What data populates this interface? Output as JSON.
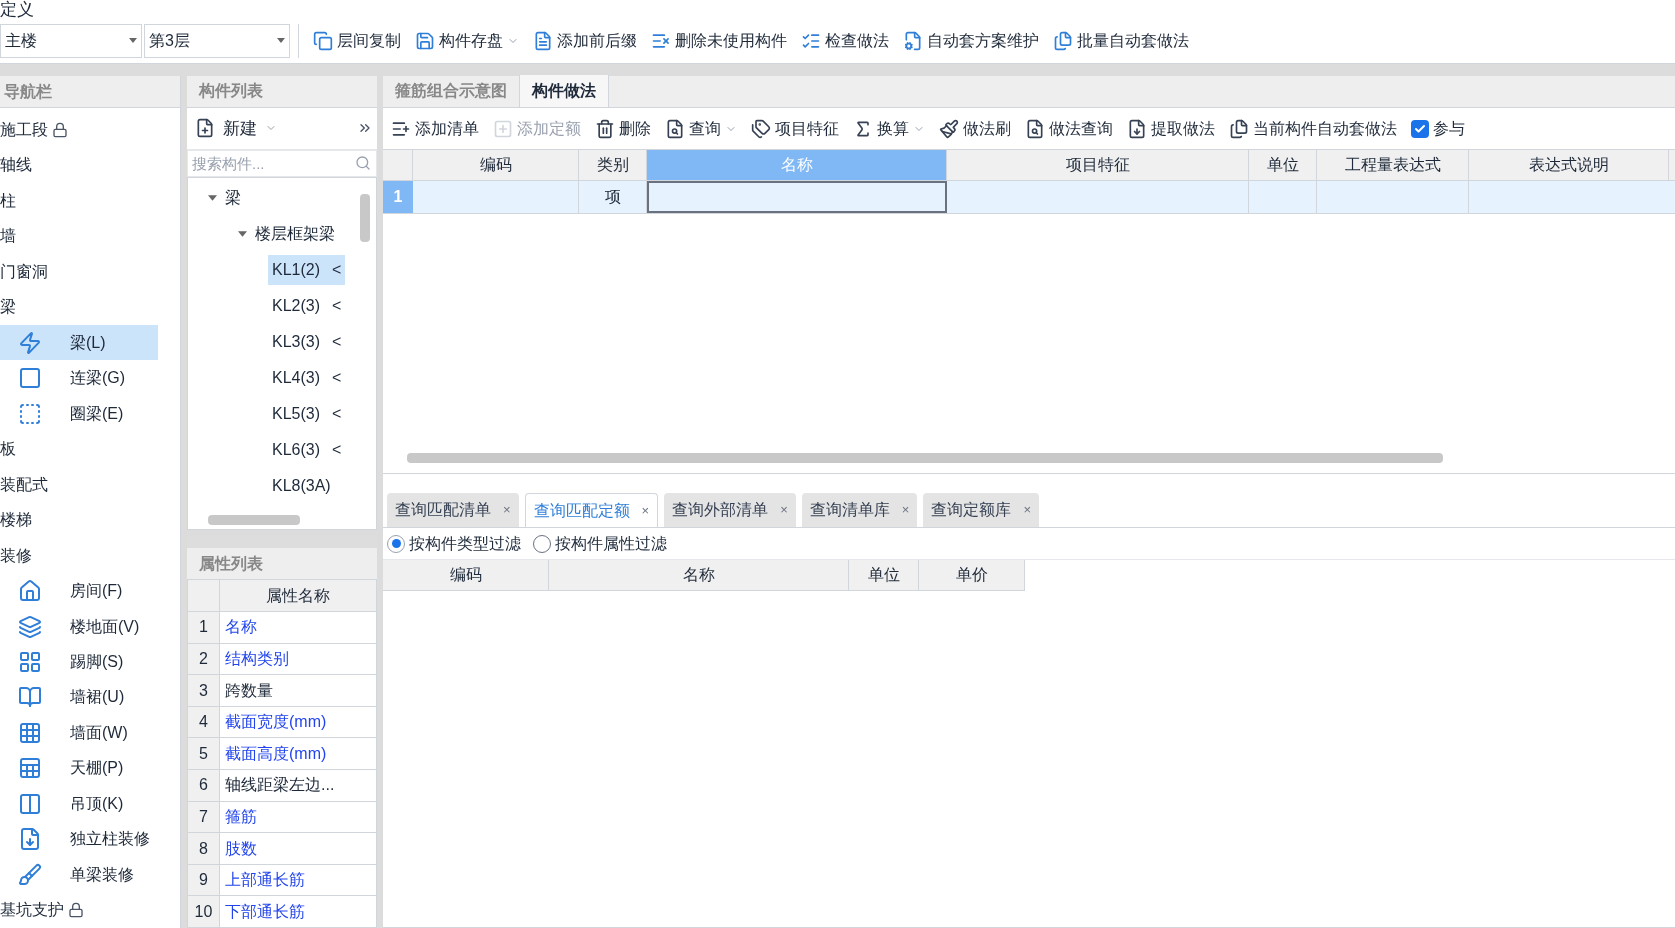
{
  "window": {
    "title": "定义"
  },
  "toolbar": {
    "building": "主楼",
    "floor": "第3层",
    "buttons": [
      {
        "label": "层间复制",
        "dropdown": false
      },
      {
        "label": "构件存盘",
        "dropdown": true
      },
      {
        "label": "添加前后缀",
        "dropdown": false
      },
      {
        "label": "删除未使用构件",
        "dropdown": false
      },
      {
        "label": "检查做法",
        "dropdown": false
      },
      {
        "label": "自动套方案维护",
        "dropdown": false
      },
      {
        "label": "批量自动套做法",
        "dropdown": false
      }
    ]
  },
  "navigation": {
    "title": "导航栏",
    "items": [
      {
        "kind": "group",
        "label": "施工段",
        "locked": true
      },
      {
        "kind": "group",
        "label": "轴线",
        "locked": false
      },
      {
        "kind": "group",
        "label": "柱",
        "locked": false
      },
      {
        "kind": "group",
        "label": "墙",
        "locked": false
      },
      {
        "kind": "group",
        "label": "门窗洞",
        "locked": false
      },
      {
        "kind": "group",
        "label": "梁",
        "locked": false
      },
      {
        "kind": "item",
        "label": "梁(L)",
        "selected": true
      },
      {
        "kind": "item",
        "label": "连梁(G)",
        "selected": false
      },
      {
        "kind": "item",
        "label": "圈梁(E)",
        "selected": false
      },
      {
        "kind": "group",
        "label": "板",
        "locked": false
      },
      {
        "kind": "group",
        "label": "装配式",
        "locked": false
      },
      {
        "kind": "group",
        "label": "楼梯",
        "locked": false
      },
      {
        "kind": "group",
        "label": "装修",
        "locked": false
      },
      {
        "kind": "item",
        "label": "房间(F)",
        "selected": false
      },
      {
        "kind": "item",
        "label": "楼地面(V)",
        "selected": false
      },
      {
        "kind": "item",
        "label": "踢脚(S)",
        "selected": false
      },
      {
        "kind": "item",
        "label": "墙裙(U)",
        "selected": false
      },
      {
        "kind": "item",
        "label": "墙面(W)",
        "selected": false
      },
      {
        "kind": "item",
        "label": "天棚(P)",
        "selected": false
      },
      {
        "kind": "item",
        "label": "吊顶(K)",
        "selected": false
      },
      {
        "kind": "item",
        "label": "独立柱装修",
        "selected": false
      },
      {
        "kind": "item",
        "label": "单梁装修",
        "selected": false
      },
      {
        "kind": "group",
        "label": "基坑支护",
        "locked": true
      }
    ]
  },
  "component_list": {
    "title": "构件列表",
    "new_button": "新建",
    "search": {
      "placeholder": "搜索构件..."
    },
    "tree": [
      {
        "label": "梁",
        "expanded": true,
        "children": [
          {
            "label": "楼层框架梁",
            "expanded": true,
            "children": [
              {
                "label": "KL1(2)",
                "marker": "<",
                "selected": true
              },
              {
                "label": "KL2(3)",
                "marker": "<",
                "selected": false
              },
              {
                "label": "KL3(3)",
                "marker": "<",
                "selected": false
              },
              {
                "label": "KL4(3)",
                "marker": "<",
                "selected": false
              },
              {
                "label": "KL5(3)",
                "marker": "<",
                "selected": false
              },
              {
                "label": "KL6(3)",
                "marker": "<",
                "selected": false
              },
              {
                "label": "KL8(3A)",
                "selected": false
              }
            ]
          }
        ]
      }
    ]
  },
  "property_list": {
    "title": "属性列表",
    "column": "属性名称",
    "rows": [
      {
        "index": "1",
        "name": "名称",
        "linked": true
      },
      {
        "index": "2",
        "name": "结构类别",
        "linked": true
      },
      {
        "index": "3",
        "name": "跨数量",
        "linked": false
      },
      {
        "index": "4",
        "name": "截面宽度(mm)",
        "linked": true
      },
      {
        "index": "5",
        "name": "截面高度(mm)",
        "linked": true
      },
      {
        "index": "6",
        "name": "轴线距梁左边...",
        "linked": false
      },
      {
        "index": "7",
        "name": "箍筋",
        "linked": true
      },
      {
        "index": "8",
        "name": "肢数",
        "linked": true
      },
      {
        "index": "9",
        "name": "上部通长筋",
        "linked": true
      },
      {
        "index": "10",
        "name": "下部通长筋",
        "linked": true
      }
    ]
  },
  "main_tabs": [
    {
      "label": "箍筋组合示意图",
      "selected": false
    },
    {
      "label": "构件做法",
      "selected": true
    }
  ],
  "method_toolbar": [
    {
      "label": "添加清单",
      "disabled": false,
      "dropdown": false
    },
    {
      "label": "添加定额",
      "disabled": true,
      "dropdown": false
    },
    {
      "label": "删除",
      "disabled": false,
      "dropdown": false
    },
    {
      "label": "查询",
      "disabled": false,
      "dropdown": true
    },
    {
      "label": "项目特征",
      "disabled": false,
      "dropdown": false
    },
    {
      "label": "换算",
      "disabled": false,
      "dropdown": true
    },
    {
      "label": "做法刷",
      "disabled": false,
      "dropdown": false
    },
    {
      "label": "做法查询",
      "disabled": false,
      "dropdown": false
    },
    {
      "label": "提取做法",
      "disabled": false,
      "dropdown": false
    },
    {
      "label": "当前构件自动套做法",
      "disabled": false,
      "dropdown": false
    }
  ],
  "participate_checkbox": {
    "label": "参与",
    "checked": true
  },
  "method_table": {
    "columns": [
      {
        "label": "编码",
        "selected": false
      },
      {
        "label": "类别",
        "selected": false
      },
      {
        "label": "名称",
        "selected": true
      },
      {
        "label": "项目特征",
        "selected": false
      },
      {
        "label": "单位",
        "selected": false
      },
      {
        "label": "工程量表达式",
        "selected": false
      },
      {
        "label": "表达式说明",
        "selected": false
      }
    ],
    "rows": [
      {
        "index": "1",
        "category": "项",
        "selected": true
      }
    ]
  },
  "query_tabs": [
    {
      "label": "查询匹配清单",
      "selected": false
    },
    {
      "label": "查询匹配定额",
      "selected": true
    },
    {
      "label": "查询外部清单",
      "selected": false
    },
    {
      "label": "查询清单库",
      "selected": false
    },
    {
      "label": "查询定额库",
      "selected": false
    }
  ],
  "close_glyph": "×",
  "filters": [
    {
      "label": "按构件类型过滤",
      "selected": true
    },
    {
      "label": "按构件属性过滤",
      "selected": false
    }
  ],
  "result_table": {
    "columns": [
      "编码",
      "名称",
      "单位",
      "单价"
    ]
  }
}
